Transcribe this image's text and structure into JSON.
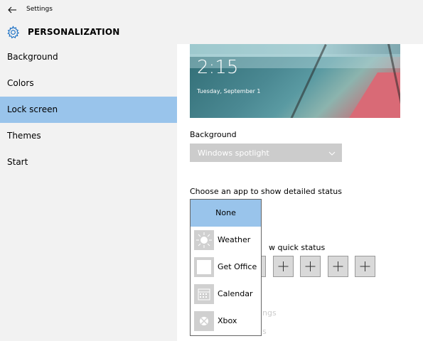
{
  "window": {
    "title": "Settings"
  },
  "header": {
    "title": "PERSONALIZATION"
  },
  "sidebar": {
    "items": [
      {
        "label": "Background"
      },
      {
        "label": "Colors"
      },
      {
        "label": "Lock screen"
      },
      {
        "label": "Themes"
      },
      {
        "label": "Start"
      }
    ],
    "active": "Lock screen"
  },
  "preview": {
    "time": "2:15",
    "date": "Tuesday, September 1"
  },
  "background_setting": {
    "label": "Background",
    "value": "Windows spotlight"
  },
  "detailed_status": {
    "label": "Choose an app to show detailed status"
  },
  "quick_status": {
    "label_visible": "w quick status",
    "slots": [
      "+",
      "+",
      "+",
      "+"
    ]
  },
  "faded": {
    "line1": "ngs",
    "line2": "s"
  },
  "popup": {
    "items": [
      {
        "label": "None",
        "icon": "none",
        "selected": true
      },
      {
        "label": "Weather",
        "icon": "weather-sun-icon",
        "selected": false
      },
      {
        "label": "Get Office",
        "icon": "office-icon",
        "selected": false
      },
      {
        "label": "Calendar",
        "icon": "calendar-icon",
        "selected": false
      },
      {
        "label": "Xbox",
        "icon": "xbox-icon",
        "selected": false
      }
    ]
  },
  "colors": {
    "accent": "#99c4eb",
    "chrome": "#f2f2f2",
    "disabled": "#cccccc"
  }
}
